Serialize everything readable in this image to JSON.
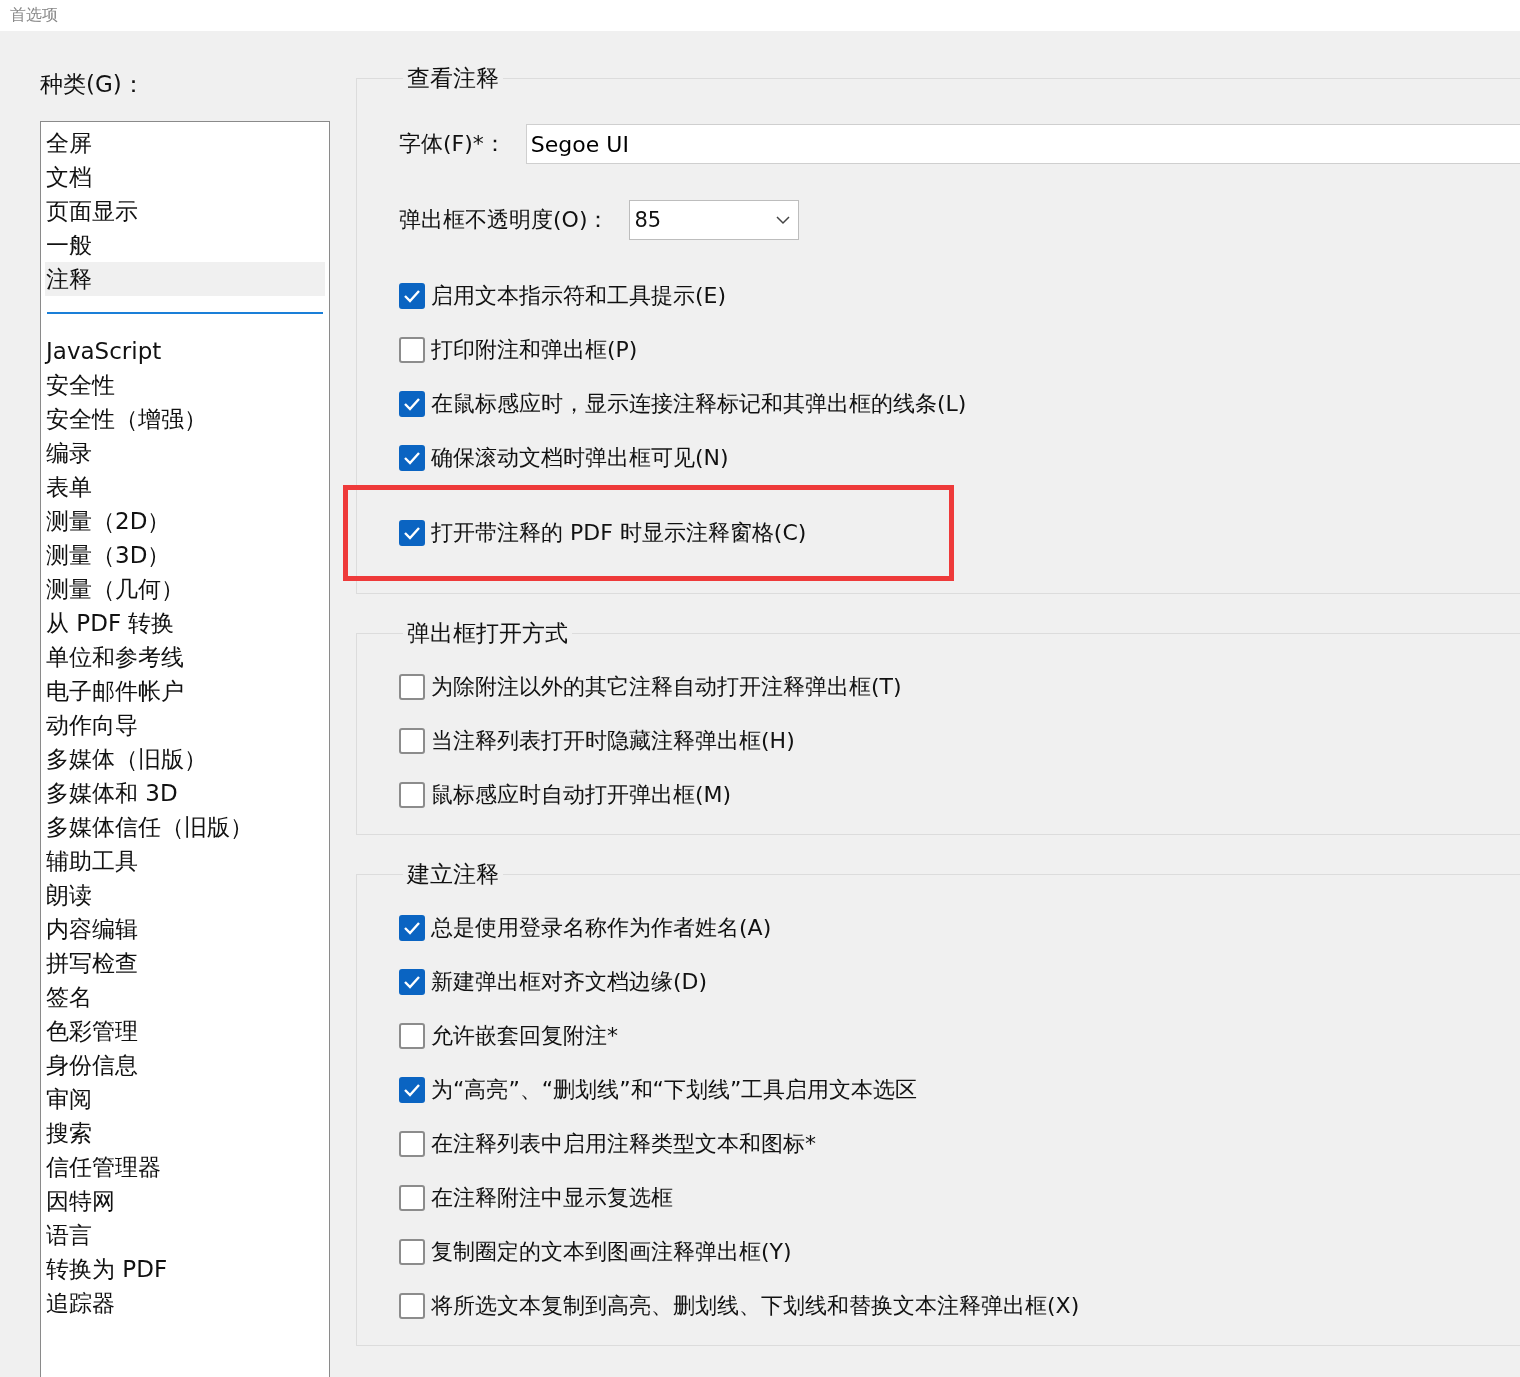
{
  "window": {
    "title": "首选项"
  },
  "categories": {
    "label": "种类(G)：",
    "groups": [
      {
        "items": [
          {
            "label": "全屏",
            "selected": false
          },
          {
            "label": "文档",
            "selected": false
          },
          {
            "label": "页面显示",
            "selected": false
          },
          {
            "label": "一般",
            "selected": false
          },
          {
            "label": "注释",
            "selected": true
          }
        ]
      },
      {
        "items": [
          {
            "label": "JavaScript",
            "selected": false
          },
          {
            "label": "安全性",
            "selected": false
          },
          {
            "label": "安全性（增强）",
            "selected": false
          },
          {
            "label": "编录",
            "selected": false
          },
          {
            "label": "表单",
            "selected": false
          },
          {
            "label": "测量（2D）",
            "selected": false
          },
          {
            "label": "测量（3D）",
            "selected": false
          },
          {
            "label": "测量（几何）",
            "selected": false
          },
          {
            "label": "从 PDF 转换",
            "selected": false
          },
          {
            "label": "单位和参考线",
            "selected": false
          },
          {
            "label": "电子邮件帐户",
            "selected": false
          },
          {
            "label": "动作向导",
            "selected": false
          },
          {
            "label": "多媒体（旧版）",
            "selected": false
          },
          {
            "label": "多媒体和 3D",
            "selected": false
          },
          {
            "label": "多媒体信任（旧版）",
            "selected": false
          },
          {
            "label": "辅助工具",
            "selected": false
          },
          {
            "label": "朗读",
            "selected": false
          },
          {
            "label": "内容编辑",
            "selected": false
          },
          {
            "label": "拼写检查",
            "selected": false
          },
          {
            "label": "签名",
            "selected": false
          },
          {
            "label": "色彩管理",
            "selected": false
          },
          {
            "label": "身份信息",
            "selected": false
          },
          {
            "label": "审阅",
            "selected": false
          },
          {
            "label": "搜索",
            "selected": false
          },
          {
            "label": "信任管理器",
            "selected": false
          },
          {
            "label": "因特网",
            "selected": false
          },
          {
            "label": "语言",
            "selected": false
          },
          {
            "label": "转换为 PDF",
            "selected": false
          },
          {
            "label": "追踪器",
            "selected": false
          }
        ]
      }
    ]
  },
  "sections": [
    {
      "title": "查看注释",
      "fields": [
        {
          "kind": "text",
          "label": "字体(F)*：",
          "value": "Segoe UI"
        },
        {
          "kind": "dropdown",
          "label": "弹出框不透明度(O)：",
          "value": "85"
        }
      ],
      "options": [
        {
          "label": "启用文本指示符和工具提示(E)",
          "checked": true,
          "highlighted": false
        },
        {
          "label": "打印附注和弹出框(P)",
          "checked": false,
          "highlighted": false
        },
        {
          "label": "在鼠标感应时，显示连接注释标记和其弹出框的线条(L)",
          "checked": true,
          "highlighted": false
        },
        {
          "label": "确保滚动文档时弹出框可见(N)",
          "checked": true,
          "highlighted": false
        },
        {
          "label": "打开带注释的 PDF 时显示注释窗格(C)",
          "checked": true,
          "highlighted": true
        }
      ]
    },
    {
      "title": "弹出框打开方式",
      "options": [
        {
          "label": "为除附注以外的其它注释自动打开注释弹出框(T)",
          "checked": false,
          "highlighted": false
        },
        {
          "label": "当注释列表打开时隐藏注释弹出框(H)",
          "checked": false,
          "highlighted": false
        },
        {
          "label": "鼠标感应时自动打开弹出框(M)",
          "checked": false,
          "highlighted": false
        }
      ]
    },
    {
      "title": "建立注释",
      "options": [
        {
          "label": "总是使用登录名称作为作者姓名(A)",
          "checked": true,
          "highlighted": false
        },
        {
          "label": "新建弹出框对齐文档边缘(D)",
          "checked": true,
          "highlighted": false
        },
        {
          "label": "允许嵌套回复附注*",
          "checked": false,
          "highlighted": false
        },
        {
          "label": "为“高亮”、“删划线”和“下划线”工具启用文本选区",
          "checked": true,
          "highlighted": false
        },
        {
          "label": "在注释列表中启用注释类型文本和图标*",
          "checked": false,
          "highlighted": false
        },
        {
          "label": "在注释附注中显示复选框",
          "checked": false,
          "highlighted": false
        },
        {
          "label": "复制圈定的文本到图画注释弹出框(Y)",
          "checked": false,
          "highlighted": false
        },
        {
          "label": "将所选文本复制到高亮、删划线、下划线和替换文本注释弹出框(X)",
          "checked": false,
          "highlighted": false
        }
      ]
    }
  ]
}
